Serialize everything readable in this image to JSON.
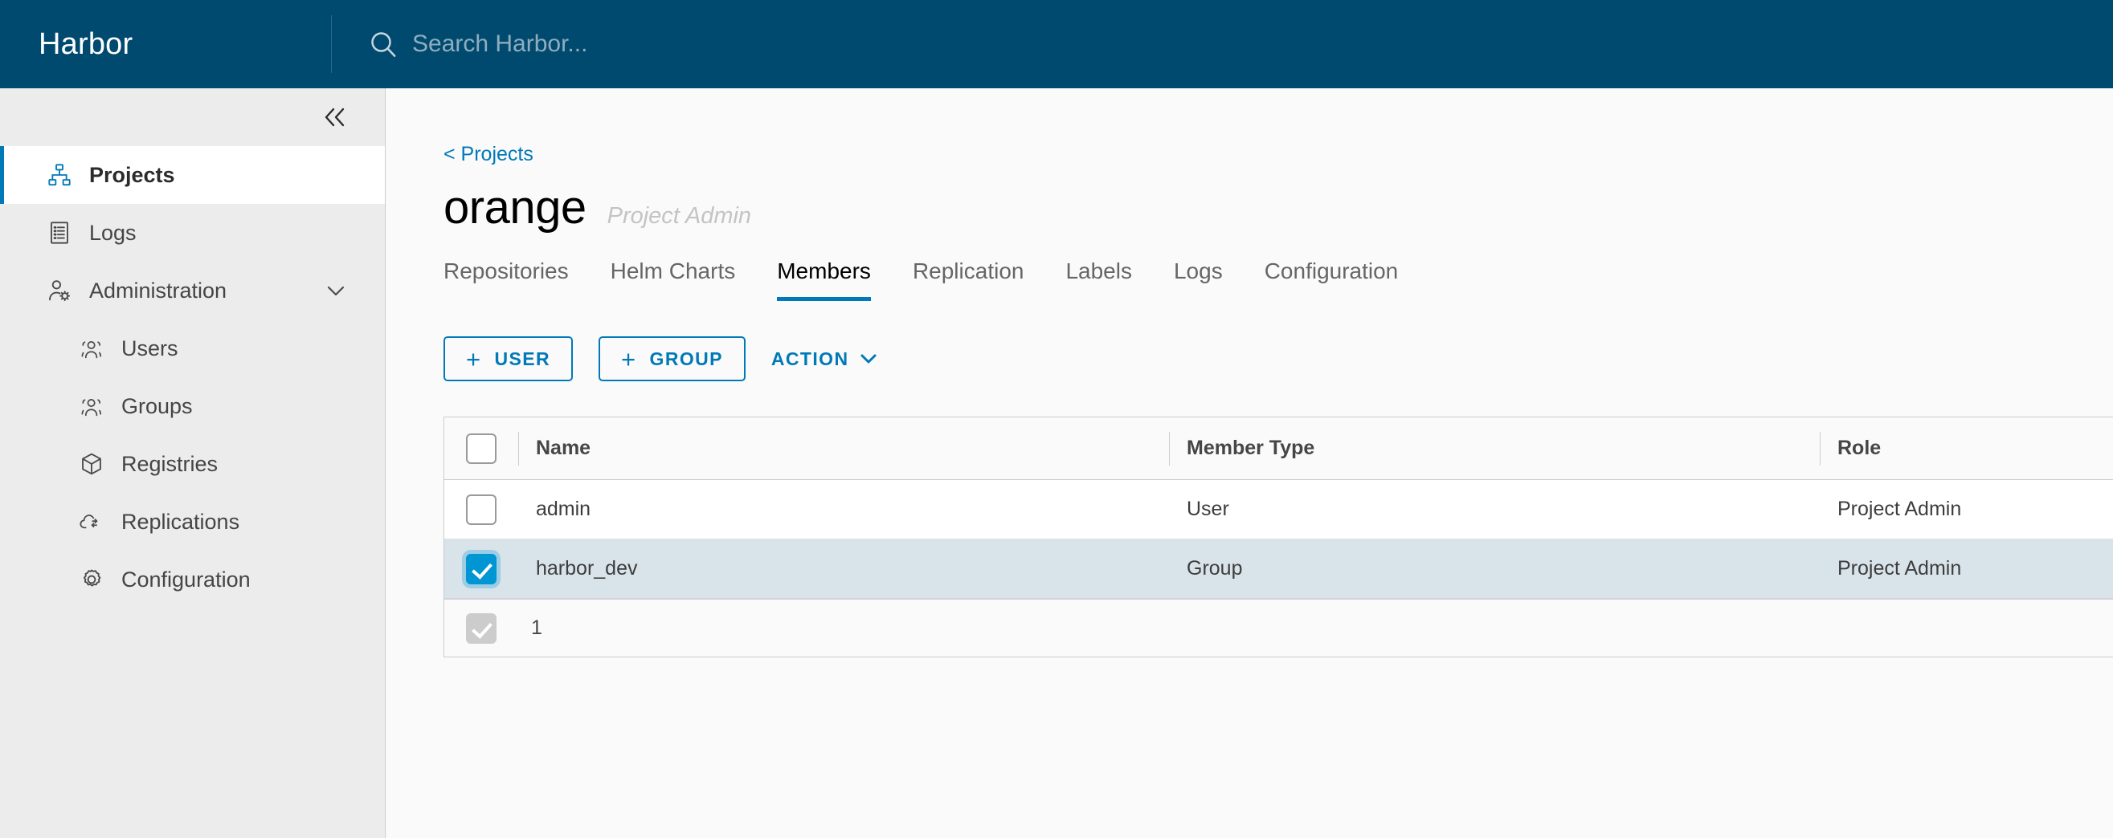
{
  "header": {
    "brand": "Harbor",
    "search_placeholder": "Search Harbor...",
    "search_value": "",
    "bg_color": "#004a70"
  },
  "sidebar": {
    "collapse_label": "«",
    "items": [
      {
        "label": "Projects",
        "icon": "projects-icon",
        "active": true,
        "sub": false
      },
      {
        "label": "Logs",
        "icon": "logs-icon",
        "active": false,
        "sub": false
      },
      {
        "label": "Administration",
        "icon": "administration-icon",
        "active": false,
        "sub": false,
        "expandable": true
      },
      {
        "label": "Users",
        "icon": "users-icon",
        "active": false,
        "sub": true
      },
      {
        "label": "Groups",
        "icon": "groups-icon",
        "active": false,
        "sub": true
      },
      {
        "label": "Registries",
        "icon": "registries-icon",
        "active": false,
        "sub": true
      },
      {
        "label": "Replications",
        "icon": "replications-icon",
        "active": false,
        "sub": true
      },
      {
        "label": "Configuration",
        "icon": "configuration-icon",
        "active": false,
        "sub": true
      }
    ]
  },
  "main": {
    "breadcrumb": "< Projects",
    "project_name": "orange",
    "project_role": "Project Admin",
    "tabs": [
      {
        "label": "Repositories",
        "active": false
      },
      {
        "label": "Helm Charts",
        "active": false
      },
      {
        "label": "Members",
        "active": true
      },
      {
        "label": "Replication",
        "active": false
      },
      {
        "label": "Labels",
        "active": false
      },
      {
        "label": "Logs",
        "active": false
      },
      {
        "label": "Configuration",
        "active": false
      }
    ],
    "toolbar": {
      "add_user_label": "USER",
      "add_group_label": "GROUP",
      "plus_glyph": "+",
      "action_label": "ACTION"
    },
    "table": {
      "columns": [
        "Name",
        "Member Type",
        "Role"
      ],
      "rows": [
        {
          "name": "admin",
          "member_type": "User",
          "role": "Project Admin",
          "selected": false
        },
        {
          "name": "harbor_dev",
          "member_type": "Group",
          "role": "Project Admin",
          "selected": true
        }
      ],
      "footer_count": "1",
      "header_checkbox_checked": false,
      "selected_row_bg": "#d9e4ea"
    }
  },
  "colors": {
    "accent": "#0079b8",
    "checkbox_checked": "#0095d3",
    "header_bg": "#004a70",
    "sidebar_bg": "#ececec",
    "content_bg": "#fafafa"
  }
}
